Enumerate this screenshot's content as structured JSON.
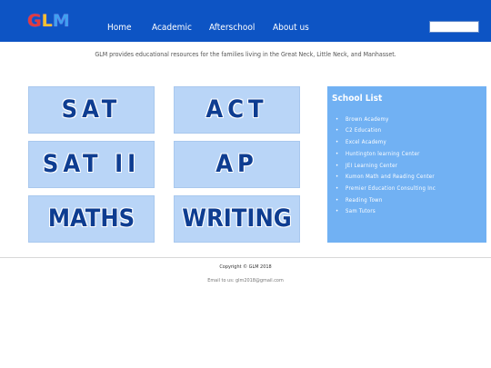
{
  "header": {
    "logo": {
      "letters": [
        "G",
        "L",
        "M"
      ]
    },
    "nav": [
      "Home",
      "Academic",
      "Afterschool",
      "About us"
    ],
    "search_value": ""
  },
  "tagline": "GLM provides educational resources for the families living in the Great Neck, Little Neck, and Manhasset.",
  "cards": [
    "SAT",
    "ACT",
    "SAT II",
    "AP",
    "MATHS",
    "WRITING"
  ],
  "school_list": {
    "title": "School List",
    "items": [
      "Brown Academy",
      "C2 Education",
      "Excel Academy",
      "Huntington learning Center",
      "JEI Learning Center",
      "Kumon Math and Reading Center",
      "Premier Education Consulting Inc",
      "Reading Town",
      "Sam Tutors"
    ]
  },
  "footer": {
    "copyright": "Copyright © GLM 2018",
    "email": "Email to us: glm2018@gmail.com"
  },
  "colors": {
    "header_bg": "#0d54c4",
    "card_bg": "#b9d5f7",
    "card_text": "#0e3d91",
    "school_list_bg": "#71b1f3"
  }
}
